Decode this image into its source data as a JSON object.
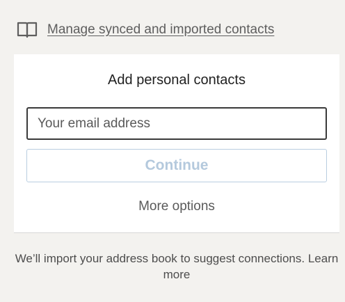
{
  "manage": {
    "icon": "book-icon",
    "link_label": "Manage synced and imported contacts"
  },
  "card": {
    "title": "Add personal contacts",
    "email_placeholder": "Your email address",
    "continue_label": "Continue",
    "more_options_label": "More options"
  },
  "footer": {
    "note_text": "We’ll import your address book to suggest connections.",
    "learn_more_label": "Learn more"
  },
  "colors": {
    "background": "#f3f2ef",
    "card": "#ffffff",
    "continue_disabled_text": "#b4c9dd",
    "continue_disabled_border": "#b9cde0"
  }
}
